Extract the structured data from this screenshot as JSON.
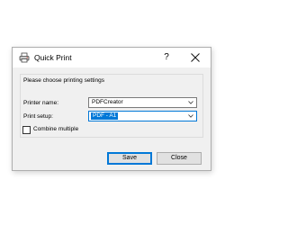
{
  "window": {
    "title": "Quick Print",
    "help_label": "?",
    "icon": "printer-icon",
    "close_icon": "close-icon"
  },
  "group": {
    "label": "Please choose printing settings"
  },
  "printer_name": {
    "label": "Printer name:",
    "value": "PDFCreator"
  },
  "print_setup": {
    "label": "Print setup:",
    "value": "PDF - A1"
  },
  "combine": {
    "label": "Combine multiple",
    "checked": false
  },
  "buttons": {
    "save_label": "Save",
    "close_label": "Close"
  },
  "colors": {
    "accent": "#0078d7",
    "dialog_bg": "#f0f0f0",
    "titlebar_bg": "#ffffff"
  }
}
